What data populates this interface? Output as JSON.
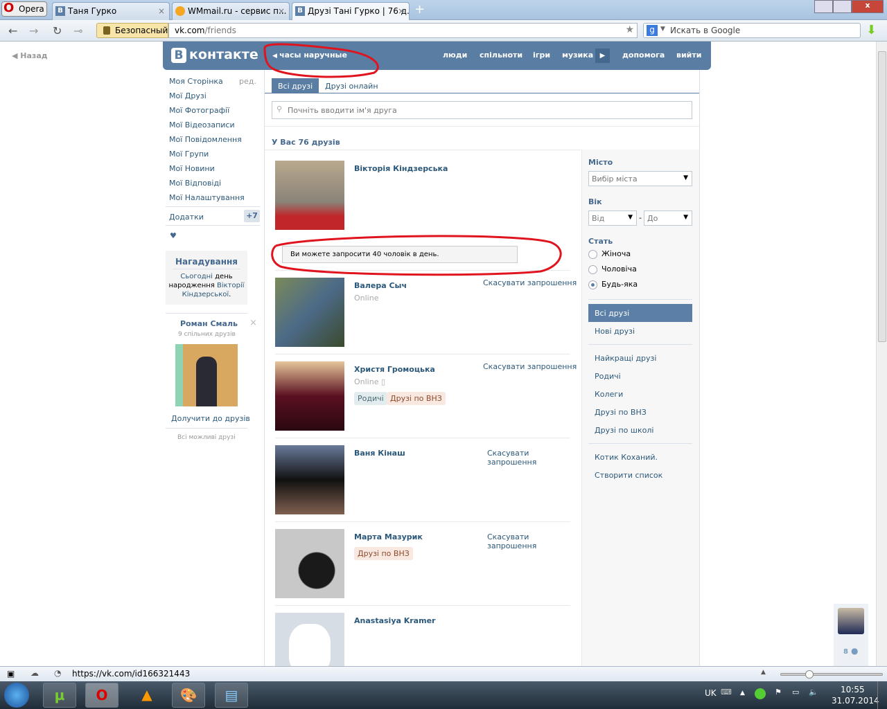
{
  "browser": {
    "menu_label": "Opera",
    "tabs": [
      {
        "title": "Таня Гурко"
      },
      {
        "title": "WMmail.ru - сервис п..."
      },
      {
        "title": "Друзі Тані Гурко | 76 д..."
      }
    ],
    "secure_label": "Безопасный",
    "url_domain": "vk.com",
    "url_path": "/friends",
    "search_placeholder": "Искать в Google",
    "status_url": "https://vk.com/id166321443"
  },
  "back_label": "Назад",
  "header": {
    "logo": "В",
    "logo_text": "контакте",
    "status_text": "часы наручные",
    "nav": [
      "люди",
      "спільноти",
      "ігри",
      "музика",
      "допомога",
      "вийти"
    ]
  },
  "left_menu": {
    "items": [
      "Моя Сторінка",
      "Мої Друзі",
      "Мої Фотографії",
      "Мої Відеозаписи",
      "Мої Повідомлення",
      "Мої Групи",
      "Мої Новини",
      "Мої Відповіді",
      "Мої Налаштування"
    ],
    "edit": "ред.",
    "apps": "Додатки",
    "apps_badge": "+7",
    "heart": "♥"
  },
  "reminder": {
    "title": "Нагадування",
    "text1": "Сьогодні",
    "text2": " день народження ",
    "link": "Вікторії Кіндзерської",
    "end": "."
  },
  "suggest": {
    "name": "Роман Смаль",
    "mutual": "9 спільних друзів",
    "add": "Долучити до друзів",
    "all": "Всі можливі друзі"
  },
  "tabs": [
    "Всі друзі",
    "Друзі онлайн"
  ],
  "search_placeholder": "Почніть вводити ім'я друга",
  "count_title": "У Вас 76 друзів",
  "invite_notice": "Ви можете запросити 40 чоловік в день.",
  "cancel_label": "Скасувати запрошення",
  "cancel_l1": "Скасувати",
  "cancel_l2": "запрошення",
  "online": "Online",
  "friends": [
    {
      "name": "Вікторія Кіндзерська"
    },
    {
      "name": "Валера Сыч"
    },
    {
      "name": "Христя Громоцька",
      "tags": [
        "Родичі",
        "Друзі по ВНЗ"
      ]
    },
    {
      "name": "Ваня Кінаш"
    },
    {
      "name": "Марта Мазурик",
      "tags": [
        "Друзі по ВНЗ"
      ]
    },
    {
      "name": "Anastasiya Kramer"
    }
  ],
  "filters": {
    "city_label": "Місто",
    "city_value": "Вибір міста",
    "age_label": "Вік",
    "age_from": "Від",
    "age_to": "До",
    "dash": "-",
    "sex_label": "Стать",
    "sex": [
      "Жіноча",
      "Чоловіча",
      "Будь-яка"
    ],
    "lists": [
      "Всі друзі",
      "Нові друзі",
      "Найкращі друзі",
      "Родичі",
      "Колеги",
      "Друзі по ВНЗ",
      "Друзі по школі",
      "Котик Коханий.",
      "Створити список"
    ]
  },
  "side_count": "8",
  "taskbar": {
    "lang": "UK",
    "time": "10:55",
    "date": "31.07.2014"
  },
  "colors": {
    "vk_blue": "#597da3",
    "link": "#2b587a",
    "annotation": "#e0141e"
  }
}
